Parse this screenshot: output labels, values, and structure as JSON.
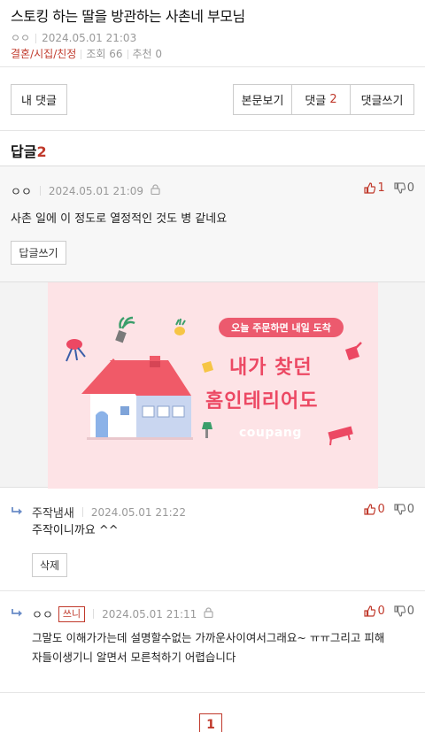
{
  "post": {
    "title": "스토킹 하는 딸을 방관하는 사촌네 부모님",
    "author": "ㅇㅇ",
    "datetime": "2024.05.01 21:03",
    "category": "결혼/시집/친정",
    "views": "조회 66",
    "recommend": "추천 0"
  },
  "toolbar": {
    "my_comments": "내 댓글",
    "view_post": "본문보기",
    "comments_label": "댓글",
    "comments_count": "2",
    "write_comment": "댓글쓰기"
  },
  "replies": {
    "label": "답글",
    "count": "2"
  },
  "comments": [
    {
      "author": "ㅇㅇ",
      "datetime": "2024.05.01 21:09",
      "text": "사촌 일에 이 정도로 열정적인 것도 병 같네요",
      "up": "1",
      "down": "0",
      "reply_button": "답글쓰기"
    },
    {
      "author": "주작냄새",
      "datetime": "2024.05.01 21:22",
      "text": "주작이니까요 ^^",
      "up": "0",
      "down": "0",
      "delete_button": "삭제"
    },
    {
      "author": "ㅇㅇ",
      "badge": "쓰니",
      "datetime": "2024.05.01 21:11",
      "text_line1": "그말도 이해가가는데 설명할수없는 가까운사이여서그래요~ ㅠㅠ그리고 피해",
      "text_line2": "자들이생기니 알면서 모른척하기 어렵습니다",
      "up": "0",
      "down": "0"
    }
  ],
  "ad": {
    "tag": "오늘 주문하면 내일 도착",
    "line1": "내가 찾던",
    "line2": "홈인테리어도",
    "brand": "coupang"
  },
  "pagination": {
    "current": "1"
  },
  "colors": {
    "accent": "#c0392b",
    "ad_pink": "#ec4863",
    "ad_bg": "#fde3e6"
  }
}
